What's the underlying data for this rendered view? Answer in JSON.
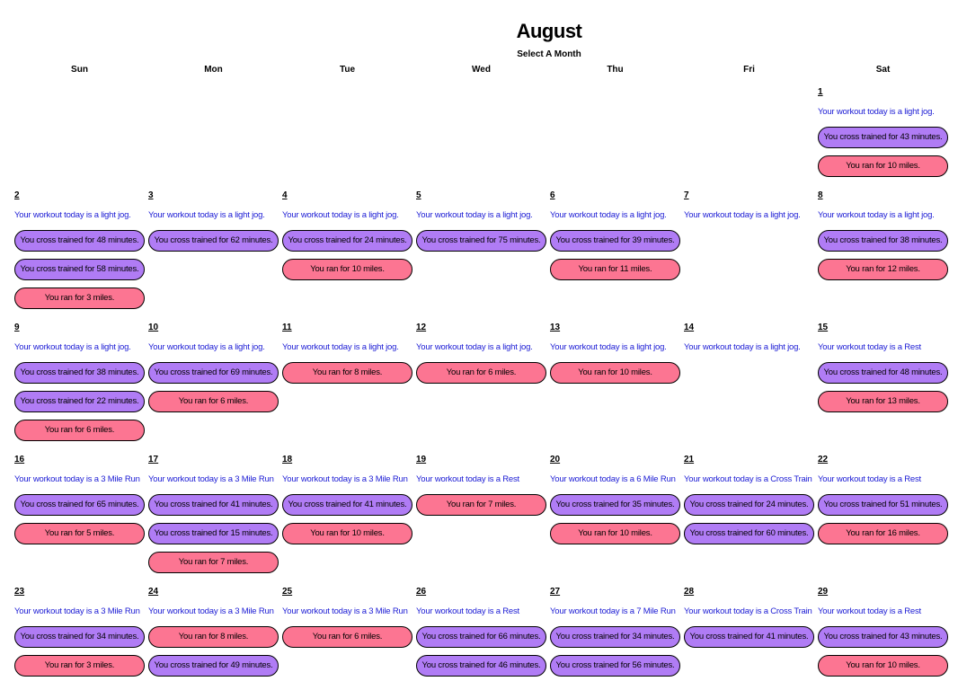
{
  "header": {
    "month": "August",
    "select_month": "Select A Month"
  },
  "weekdays": [
    "Sun",
    "Mon",
    "Tue",
    "Wed",
    "Thu",
    "Fri",
    "Sat"
  ],
  "colors": {
    "cross_pill": "#b07cf5",
    "run_pill": "#fc7592",
    "workout_text": "#1a1ad4"
  },
  "first_weekday_index": 6,
  "days": [
    {
      "num": "1",
      "workout": "Your workout today is a light jog.",
      "entries": [
        {
          "type": "cross",
          "text": "You cross trained for 43 minutes."
        },
        {
          "type": "run",
          "text": "You ran for 10 miles."
        }
      ]
    },
    {
      "num": "2",
      "workout": "Your workout today is a light jog.",
      "entries": [
        {
          "type": "cross",
          "text": "You cross trained for 48 minutes."
        },
        {
          "type": "cross",
          "text": "You cross trained for 58 minutes."
        },
        {
          "type": "run",
          "text": "You ran for 3 miles."
        }
      ]
    },
    {
      "num": "3",
      "workout": "Your workout today is a light jog.",
      "entries": [
        {
          "type": "cross",
          "text": "You cross trained for 62 minutes."
        }
      ]
    },
    {
      "num": "4",
      "workout": "Your workout today is a light jog.",
      "entries": [
        {
          "type": "cross",
          "text": "You cross trained for 24 minutes."
        },
        {
          "type": "run",
          "text": "You ran for 10 miles."
        }
      ]
    },
    {
      "num": "5",
      "workout": "Your workout today is a light jog.",
      "entries": [
        {
          "type": "cross",
          "text": "You cross trained for 75 minutes."
        }
      ]
    },
    {
      "num": "6",
      "workout": "Your workout today is a light jog.",
      "entries": [
        {
          "type": "cross",
          "text": "You cross trained for 39 minutes."
        },
        {
          "type": "run",
          "text": "You ran for 11 miles."
        }
      ]
    },
    {
      "num": "7",
      "workout": "Your workout today is a light jog.",
      "entries": []
    },
    {
      "num": "8",
      "workout": "Your workout today is a light jog.",
      "entries": [
        {
          "type": "cross",
          "text": "You cross trained for 38 minutes."
        },
        {
          "type": "run",
          "text": "You ran for 12 miles."
        }
      ]
    },
    {
      "num": "9",
      "workout": "Your workout today is a light jog.",
      "entries": [
        {
          "type": "cross",
          "text": "You cross trained for 38 minutes."
        },
        {
          "type": "cross",
          "text": "You cross trained for 22 minutes."
        },
        {
          "type": "run",
          "text": "You ran for 6 miles."
        }
      ]
    },
    {
      "num": "10",
      "workout": "Your workout today is a light jog.",
      "entries": [
        {
          "type": "cross",
          "text": "You cross trained for 69 minutes."
        },
        {
          "type": "run",
          "text": "You ran for 6 miles."
        }
      ]
    },
    {
      "num": "11",
      "workout": "Your workout today is a light jog.",
      "entries": [
        {
          "type": "run",
          "text": "You ran for 8 miles."
        }
      ]
    },
    {
      "num": "12",
      "workout": "Your workout today is a light jog.",
      "entries": [
        {
          "type": "run",
          "text": "You ran for 6 miles."
        }
      ]
    },
    {
      "num": "13",
      "workout": "Your workout today is a light jog.",
      "entries": [
        {
          "type": "run",
          "text": "You ran for 10 miles."
        }
      ]
    },
    {
      "num": "14",
      "workout": "Your workout today is a light jog.",
      "entries": []
    },
    {
      "num": "15",
      "workout": "Your workout today is a Rest",
      "entries": [
        {
          "type": "cross",
          "text": "You cross trained for 48 minutes."
        },
        {
          "type": "run",
          "text": "You ran for 13 miles."
        }
      ]
    },
    {
      "num": "16",
      "workout": "Your workout today is a 3 Mile Run",
      "entries": [
        {
          "type": "cross",
          "text": "You cross trained for 65 minutes."
        },
        {
          "type": "run",
          "text": "You ran for 5 miles."
        }
      ]
    },
    {
      "num": "17",
      "workout": "Your workout today is a 3 Mile Run",
      "entries": [
        {
          "type": "cross",
          "text": "You cross trained for 41 minutes."
        },
        {
          "type": "cross",
          "text": "You cross trained for 15 minutes."
        },
        {
          "type": "run",
          "text": "You ran for 7 miles."
        }
      ]
    },
    {
      "num": "18",
      "workout": "Your workout today is a 3 Mile Run",
      "entries": [
        {
          "type": "cross",
          "text": "You cross trained for 41 minutes."
        },
        {
          "type": "run",
          "text": "You ran for 10 miles."
        }
      ]
    },
    {
      "num": "19",
      "workout": "Your workout today is a Rest",
      "entries": [
        {
          "type": "run",
          "text": "You ran for 7 miles."
        }
      ]
    },
    {
      "num": "20",
      "workout": "Your workout today is a 6 Mile Run",
      "entries": [
        {
          "type": "cross",
          "text": "You cross trained for 35 minutes."
        },
        {
          "type": "run",
          "text": "You ran for 10 miles."
        }
      ]
    },
    {
      "num": "21",
      "workout": "Your workout today is a Cross Train",
      "entries": [
        {
          "type": "cross",
          "text": "You cross trained for 24 minutes."
        },
        {
          "type": "cross",
          "text": "You cross trained for 60 minutes."
        }
      ]
    },
    {
      "num": "22",
      "workout": "Your workout today is a Rest",
      "entries": [
        {
          "type": "cross",
          "text": "You cross trained for 51 minutes."
        },
        {
          "type": "run",
          "text": "You ran for 16 miles."
        }
      ]
    },
    {
      "num": "23",
      "workout": "Your workout today is a 3 Mile Run",
      "entries": [
        {
          "type": "cross",
          "text": "You cross trained for 34 minutes."
        },
        {
          "type": "run",
          "text": "You ran for 3 miles."
        }
      ]
    },
    {
      "num": "24",
      "workout": "Your workout today is a 3 Mile Run",
      "entries": [
        {
          "type": "run",
          "text": "You ran for 8 miles."
        },
        {
          "type": "cross",
          "text": "You cross trained for 49 minutes."
        }
      ]
    },
    {
      "num": "25",
      "workout": "Your workout today is a 3 Mile Run",
      "entries": [
        {
          "type": "run",
          "text": "You ran for 6 miles."
        }
      ]
    },
    {
      "num": "26",
      "workout": "Your workout today is a Rest",
      "entries": [
        {
          "type": "cross",
          "text": "You cross trained for 66 minutes."
        },
        {
          "type": "cross",
          "text": "You cross trained for 46 minutes."
        }
      ]
    },
    {
      "num": "27",
      "workout": "Your workout today is a 7 Mile Run",
      "entries": [
        {
          "type": "cross",
          "text": "You cross trained for 34 minutes."
        },
        {
          "type": "cross",
          "text": "You cross trained for 56 minutes."
        }
      ]
    },
    {
      "num": "28",
      "workout": "Your workout today is a Cross Train",
      "entries": [
        {
          "type": "cross",
          "text": "You cross trained for 41 minutes."
        }
      ]
    },
    {
      "num": "29",
      "workout": "Your workout today is a Rest",
      "entries": [
        {
          "type": "cross",
          "text": "You cross trained for 43 minutes."
        },
        {
          "type": "run",
          "text": "You ran for 10 miles."
        }
      ]
    }
  ]
}
